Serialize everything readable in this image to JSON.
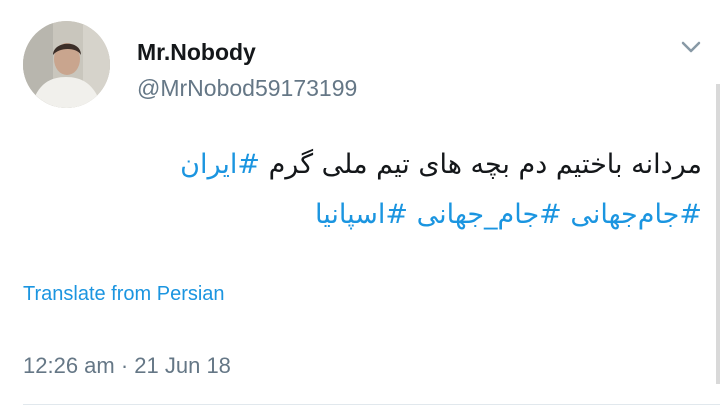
{
  "tweet": {
    "author": {
      "display_name": "Mr.Nobody",
      "handle": "@MrNobod59173199"
    },
    "menu_icon": "chevron-down-icon",
    "text_parts": [
      {
        "type": "text",
        "value": "مردانه باختیم دم بچه های تیم ملی گرم "
      },
      {
        "type": "hashtag",
        "value": "#ایران"
      },
      {
        "type": "text",
        "value": " "
      },
      {
        "type": "hashtag",
        "value": "#جام‌جهانی"
      },
      {
        "type": "text",
        "value": " "
      },
      {
        "type": "hashtag",
        "value": "#جام_جهانی"
      },
      {
        "type": "text",
        "value": " "
      },
      {
        "type": "hashtag",
        "value": "#اسپانیا"
      }
    ],
    "translate_label": "Translate from Persian",
    "timestamp": "12:26 am · 21 Jun 18"
  },
  "colors": {
    "link": "#1b95e0",
    "text": "#14171a",
    "muted": "#657786",
    "divider": "#e1e8ed"
  }
}
